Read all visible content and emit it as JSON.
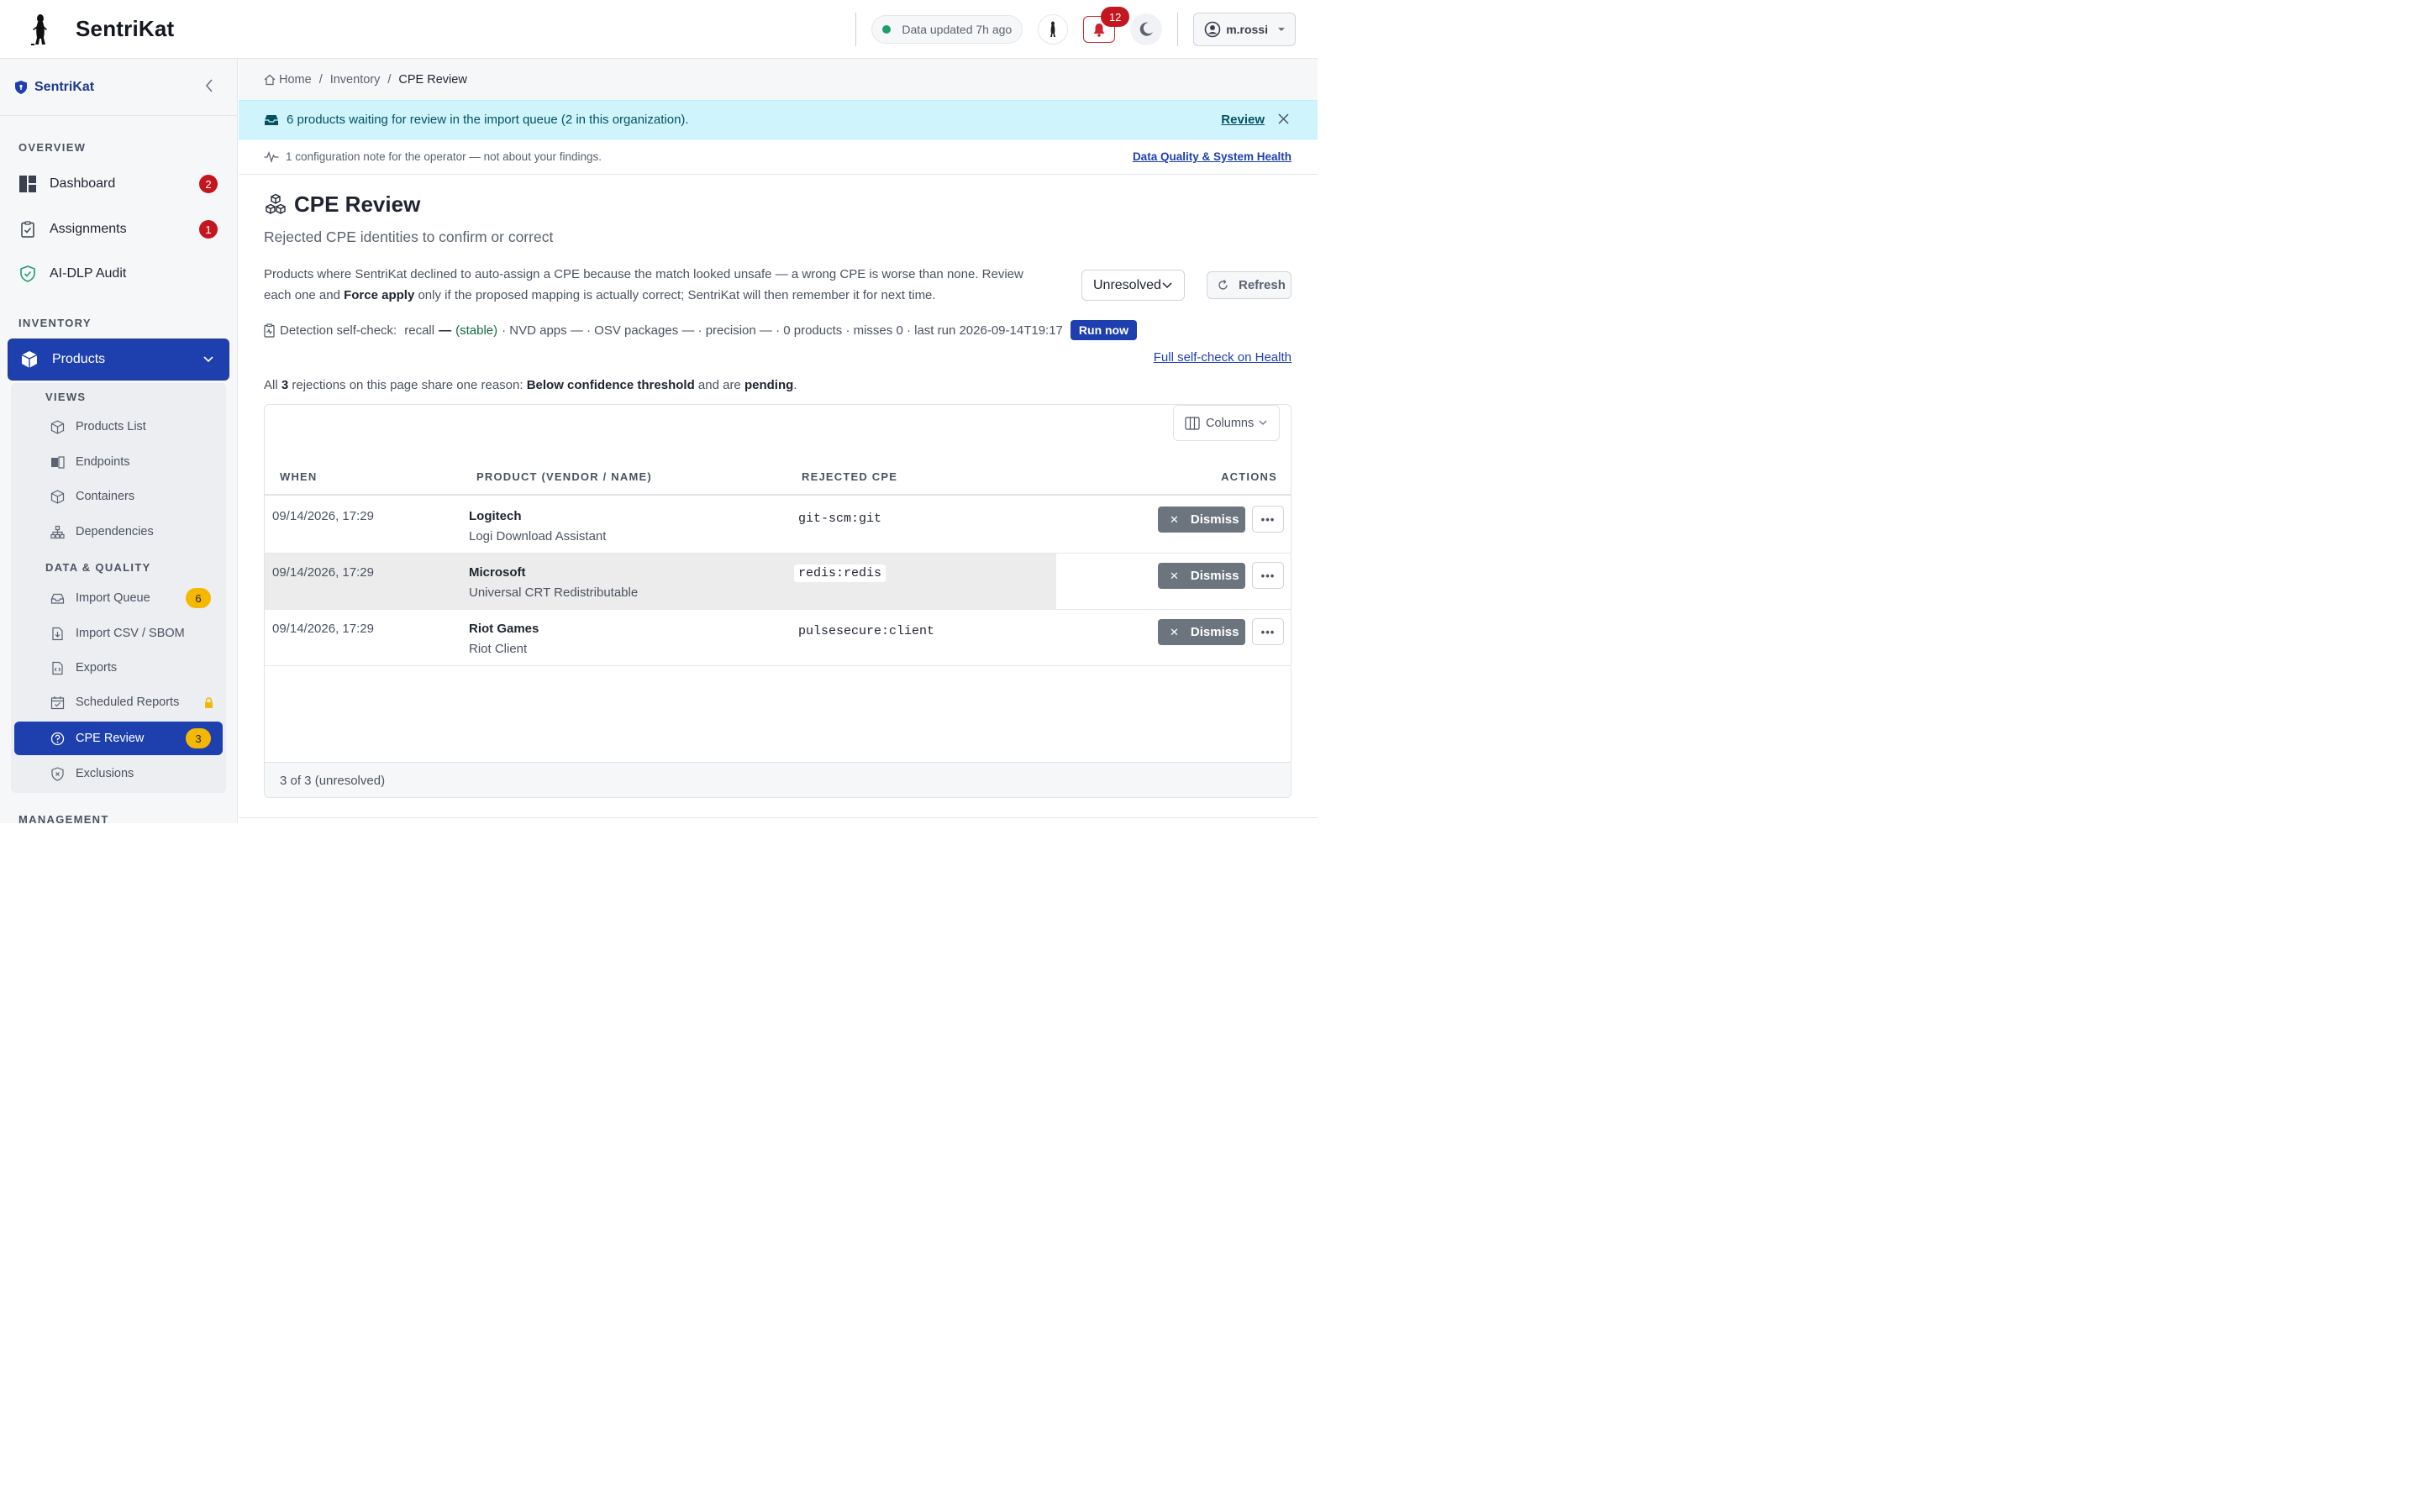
{
  "app": {
    "name": "SentriKat"
  },
  "header": {
    "status_text": "Data updated 7h ago",
    "notifications_count": "12",
    "user": "m.rossi"
  },
  "sidebar": {
    "title": "SentriKat",
    "sections": {
      "overview": "OVERVIEW",
      "inventory": "INVENTORY",
      "management": "MANAGEMENT"
    },
    "items": [
      {
        "label": "Dashboard",
        "badge": "2"
      },
      {
        "label": "Assignments",
        "badge": "1"
      },
      {
        "label": "AI-DLP Audit"
      },
      {
        "label": "Products"
      }
    ],
    "subsections": {
      "views": "VIEWS",
      "data_quality": "DATA & QUALITY"
    },
    "subitems": [
      {
        "label": "Products List"
      },
      {
        "label": "Endpoints"
      },
      {
        "label": "Containers"
      },
      {
        "label": "Dependencies"
      },
      {
        "label": "Import Queue",
        "badge": "6"
      },
      {
        "label": "Import CSV / SBOM"
      },
      {
        "label": "Exports"
      },
      {
        "label": "Scheduled Reports"
      },
      {
        "label": "CPE Review",
        "badge": "3"
      },
      {
        "label": "Exclusions"
      }
    ]
  },
  "breadcrumb": [
    "Home",
    "Inventory",
    "CPE Review"
  ],
  "banner": {
    "text": "6 products waiting for review in the import queue (2 in this organization).",
    "link": "Review"
  },
  "note": {
    "text": "1 configuration note for the operator — not about your findings.",
    "link": "Data Quality & System Health"
  },
  "page": {
    "title": "CPE Review",
    "subtitle": "Rejected CPE identities to confirm or correct",
    "desc_1": "Products where SentriKat declined to auto-assign a CPE because the match looked unsafe — a wrong CPE is worse than none. Review each one and ",
    "desc_bold": "Force apply",
    "desc_2": " only if the proposed mapping is actually correct; SentriKat will then remember it for next time.",
    "filter_value": "Unresolved",
    "refresh_label": "Refresh"
  },
  "selfcheck": {
    "prefix": "Detection self-check:",
    "recall": "recall",
    "dash": "—",
    "stable_open": "(",
    "stable": "stable",
    "stable_close": ")",
    "rest": "· NVD apps — · OSV packages — · precision — · 0 products · misses 0 · last run 2026-09-14T19:17",
    "run_now": "Run now",
    "full_link": "Full self-check on Health"
  },
  "summary": {
    "p1": "All ",
    "count": "3",
    "p2": " rejections on this page share one reason: ",
    "reason": "Below confidence threshold",
    "p3": " and are ",
    "state": "pending",
    "p4": "."
  },
  "table": {
    "columns_label": "Columns",
    "headers": [
      "WHEN",
      "PRODUCT (VENDOR / NAME)",
      "REJECTED CPE",
      "ACTIONS"
    ],
    "rows": [
      {
        "when": "09/14/2026, 17:29",
        "vendor": "Logitech",
        "name": "Logi Download Assistant",
        "cpe": "git-scm:git",
        "action": "Dismiss"
      },
      {
        "when": "09/14/2026, 17:29",
        "vendor": "Microsoft",
        "name": "Universal CRT Redistributable",
        "cpe": "redis:redis",
        "action": "Dismiss"
      },
      {
        "when": "09/14/2026, 17:29",
        "vendor": "Riot Games",
        "name": "Riot Client",
        "cpe": "pulsesecure:client",
        "action": "Dismiss"
      }
    ],
    "footer": "3 of 3 (unresolved)"
  },
  "colors": {
    "primary": "#1e40af",
    "danger": "#c3161f",
    "warning": "#f5b800",
    "info_bg": "#cff4fc",
    "success": "#1f9d6b"
  }
}
